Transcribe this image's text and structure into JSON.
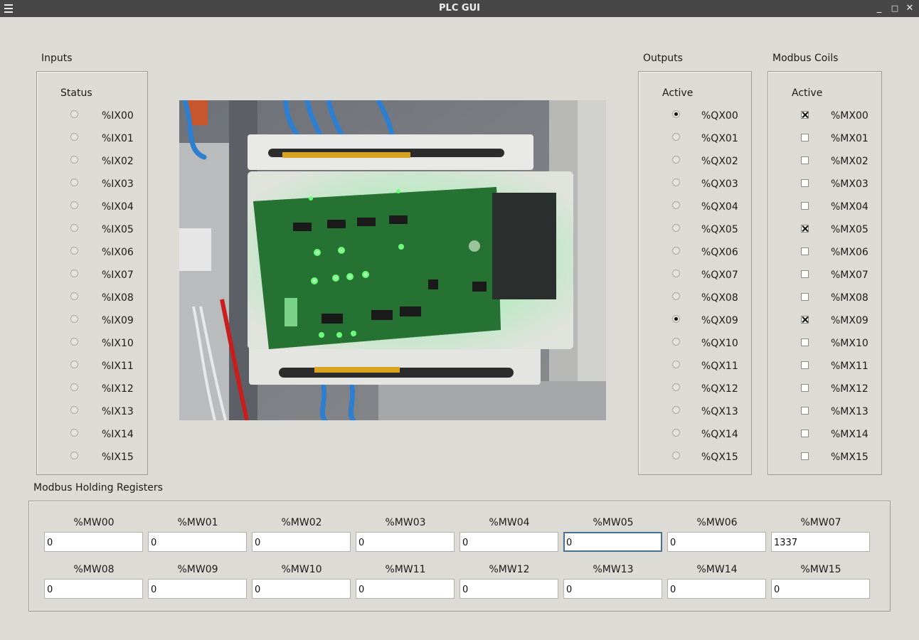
{
  "window": {
    "title": "PLC GUI",
    "minimize": "_",
    "maximize": "□",
    "close": "✕"
  },
  "inputs": {
    "title": "Inputs",
    "column": "Status",
    "items": [
      {
        "label": "%IX00",
        "on": false
      },
      {
        "label": "%IX01",
        "on": false
      },
      {
        "label": "%IX02",
        "on": false
      },
      {
        "label": "%IX03",
        "on": false
      },
      {
        "label": "%IX04",
        "on": false
      },
      {
        "label": "%IX05",
        "on": false
      },
      {
        "label": "%IX06",
        "on": false
      },
      {
        "label": "%IX07",
        "on": false
      },
      {
        "label": "%IX08",
        "on": false
      },
      {
        "label": "%IX09",
        "on": false
      },
      {
        "label": "%IX10",
        "on": false
      },
      {
        "label": "%IX11",
        "on": false
      },
      {
        "label": "%IX12",
        "on": false
      },
      {
        "label": "%IX13",
        "on": false
      },
      {
        "label": "%IX14",
        "on": false
      },
      {
        "label": "%IX15",
        "on": false
      }
    ]
  },
  "outputs": {
    "title": "Outputs",
    "column": "Active",
    "items": [
      {
        "label": "%QX00",
        "on": true
      },
      {
        "label": "%QX01",
        "on": false
      },
      {
        "label": "%QX02",
        "on": false
      },
      {
        "label": "%QX03",
        "on": false
      },
      {
        "label": "%QX04",
        "on": false
      },
      {
        "label": "%QX05",
        "on": false
      },
      {
        "label": "%QX06",
        "on": false
      },
      {
        "label": "%QX07",
        "on": false
      },
      {
        "label": "%QX08",
        "on": false
      },
      {
        "label": "%QX09",
        "on": true
      },
      {
        "label": "%QX10",
        "on": false
      },
      {
        "label": "%QX11",
        "on": false
      },
      {
        "label": "%QX12",
        "on": false
      },
      {
        "label": "%QX13",
        "on": false
      },
      {
        "label": "%QX14",
        "on": false
      },
      {
        "label": "%QX15",
        "on": false
      }
    ]
  },
  "coils": {
    "title": "Modbus Coils",
    "column": "Active",
    "items": [
      {
        "label": "%MX00",
        "on": true
      },
      {
        "label": "%MX01",
        "on": false
      },
      {
        "label": "%MX02",
        "on": false
      },
      {
        "label": "%MX03",
        "on": false
      },
      {
        "label": "%MX04",
        "on": false
      },
      {
        "label": "%MX05",
        "on": true
      },
      {
        "label": "%MX06",
        "on": false
      },
      {
        "label": "%MX07",
        "on": false
      },
      {
        "label": "%MX08",
        "on": false
      },
      {
        "label": "%MX09",
        "on": true
      },
      {
        "label": "%MX10",
        "on": false
      },
      {
        "label": "%MX11",
        "on": false
      },
      {
        "label": "%MX12",
        "on": false
      },
      {
        "label": "%MX13",
        "on": false
      },
      {
        "label": "%MX14",
        "on": false
      },
      {
        "label": "%MX15",
        "on": false
      }
    ]
  },
  "registers": {
    "title": "Modbus Holding Registers",
    "items": [
      {
        "label": "%MW00",
        "value": "0"
      },
      {
        "label": "%MW01",
        "value": "0"
      },
      {
        "label": "%MW02",
        "value": "0"
      },
      {
        "label": "%MW03",
        "value": "0"
      },
      {
        "label": "%MW04",
        "value": "0"
      },
      {
        "label": "%MW05",
        "value": "0",
        "focused": true
      },
      {
        "label": "%MW06",
        "value": "0"
      },
      {
        "label": "%MW07",
        "value": "1337"
      },
      {
        "label": "%MW08",
        "value": "0"
      },
      {
        "label": "%MW09",
        "value": "0"
      },
      {
        "label": "%MW10",
        "value": "0"
      },
      {
        "label": "%MW11",
        "value": "0"
      },
      {
        "label": "%MW12",
        "value": "0"
      },
      {
        "label": "%MW13",
        "value": "0"
      },
      {
        "label": "%MW14",
        "value": "0"
      },
      {
        "label": "%MW15",
        "value": "0"
      }
    ]
  },
  "colors": {
    "window_bg": "#dcdbd6",
    "titlebar_bg": "#474747",
    "led_green": "#39ff5a",
    "focus_border": "#4a6f93"
  }
}
